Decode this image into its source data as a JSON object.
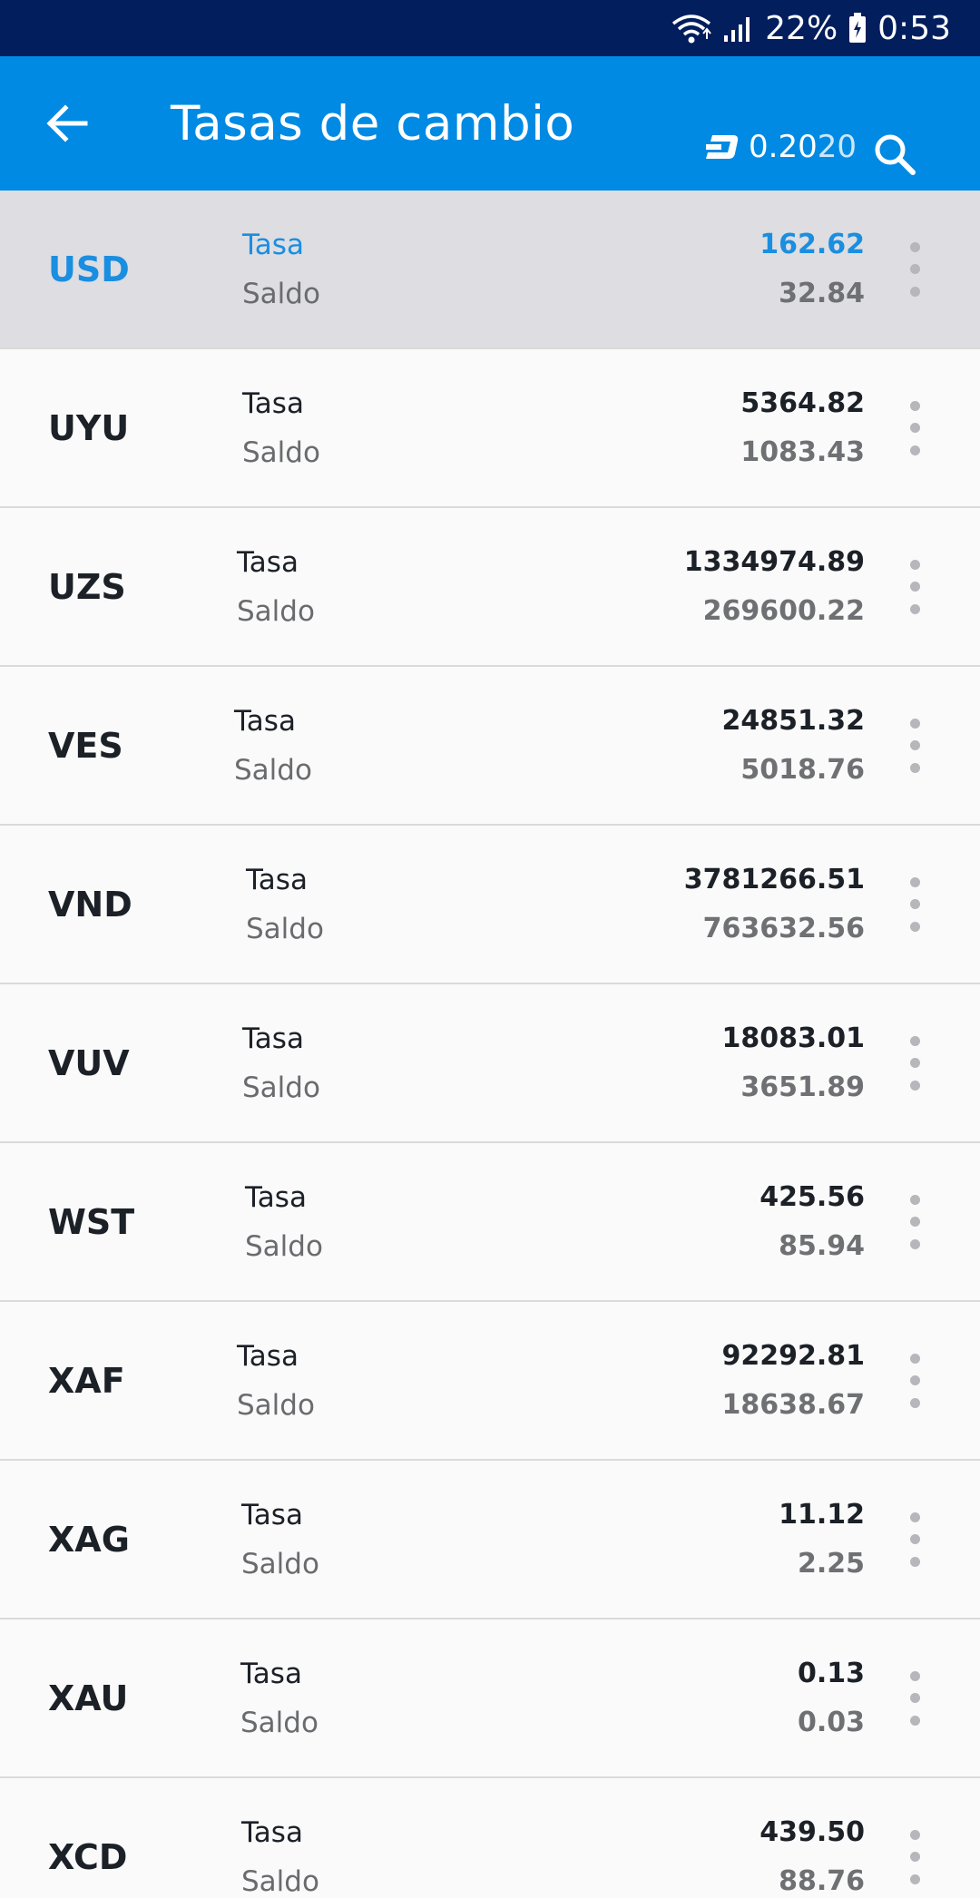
{
  "status_bar": {
    "battery": "22%",
    "time": "0:53"
  },
  "app_bar": {
    "title": "Tasas de cambio",
    "balance_main": "0.20",
    "balance_small": "20"
  },
  "labels": {
    "rate": "Tasa",
    "balance": "Saldo"
  },
  "rows": [
    {
      "code": "USD",
      "rate": "162.62",
      "balance": "32.84",
      "selected": true
    },
    {
      "code": "UYU",
      "rate": "5364.82",
      "balance": "1083.43"
    },
    {
      "code": "UZS",
      "rate": "1334974.89",
      "balance": "269600.22"
    },
    {
      "code": "VES",
      "rate": "24851.32",
      "balance": "5018.76"
    },
    {
      "code": "VND",
      "rate": "3781266.51",
      "balance": "763632.56"
    },
    {
      "code": "VUV",
      "rate": "18083.01",
      "balance": "3651.89"
    },
    {
      "code": "WST",
      "rate": "425.56",
      "balance": "85.94"
    },
    {
      "code": "XAF",
      "rate": "92292.81",
      "balance": "18638.67"
    },
    {
      "code": "XAG",
      "rate": "11.12",
      "balance": "2.25"
    },
    {
      "code": "XAU",
      "rate": "0.13",
      "balance": "0.03"
    },
    {
      "code": "XCD",
      "rate": "439.50",
      "balance": "88.76"
    }
  ],
  "colors": {
    "status_bar": "#021e5c",
    "app_bar": "#018ae3",
    "accent": "#1a8ee0",
    "selected_row": "#dddde2"
  }
}
